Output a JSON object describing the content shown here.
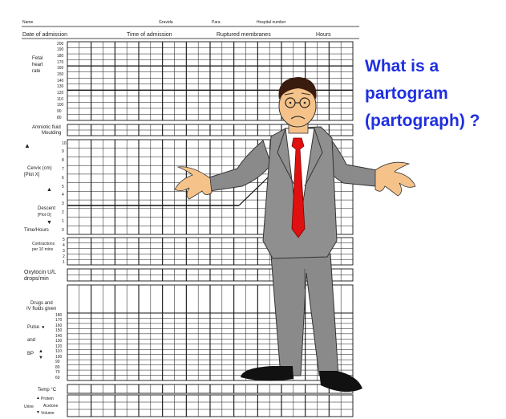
{
  "header_row1": {
    "name": "Name",
    "gravida": "Gravida",
    "para": "Para",
    "hospital_number": "Hospital number"
  },
  "header_row2": {
    "date_of_admission": "Date of admission",
    "time_of_admission": "Time of admission",
    "ruptured_membranes": "Ruptured membranes",
    "hours": "Hours"
  },
  "fetal_heart_rate": {
    "label_lines": [
      "Fetal",
      "heart",
      "rate"
    ],
    "ticks": [
      "200",
      "190",
      "180",
      "170",
      "160",
      "150",
      "140",
      "130",
      "120",
      "110",
      "100",
      "90",
      "80"
    ]
  },
  "amniotic_fluid": {
    "label_lines": [
      "Amniotic fluid",
      "Moulding"
    ]
  },
  "cervix": {
    "label_lines": [
      "Cervix (cm)",
      "[Plot X]"
    ],
    "ticks": [
      "10",
      "9",
      "8",
      "7",
      "6",
      "5",
      "4",
      "3",
      "2",
      "1",
      "0"
    ]
  },
  "descent": {
    "label_lines": [
      "Descent",
      "[Plot O]"
    ]
  },
  "time": {
    "label": "Time/Hours"
  },
  "contractions": {
    "label_lines": [
      "Contractions",
      "per 10 mins"
    ],
    "ticks": [
      "5",
      "4",
      "3",
      "2",
      "1"
    ]
  },
  "oxytocin": {
    "label_lines": [
      "Oxytocin U/L",
      "drops/min"
    ]
  },
  "drugs": {
    "label_lines": [
      "Drugs and",
      "IV fluids given"
    ]
  },
  "pulse_bp": {
    "pulse_label": "Pulse",
    "and_label": "and",
    "bp_label": "BP",
    "ticks": [
      "180",
      "170",
      "160",
      "150",
      "140",
      "130",
      "120",
      "110",
      "100",
      "90",
      "80",
      "70",
      "60"
    ]
  },
  "temp": {
    "label": "Temp °C"
  },
  "urine": {
    "label": "Urine",
    "rows": [
      "Protein",
      "Acetone",
      "Volume"
    ]
  },
  "question": {
    "lines": [
      "What is a",
      "partogram",
      "(partograph) ?"
    ]
  },
  "colors": {
    "question_text": "#1f2fe0",
    "suit": "#8a8a8a",
    "tie": "#e01010",
    "skin": "#f5c28a"
  }
}
